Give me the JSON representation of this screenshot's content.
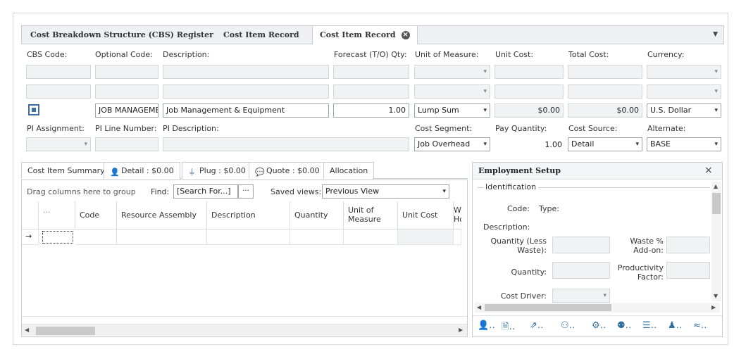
{
  "tabs": [
    {
      "label": "Cost Breakdown Structure (CBS) Register"
    },
    {
      "label": "Cost Item Record"
    },
    {
      "label": "Cost Item Record",
      "close": "⊗"
    }
  ],
  "header_labels": {
    "cbs_code": "CBS Code:",
    "optional_code": "Optional Code:",
    "description": "Description:",
    "forecast_qty": "Forecast (T/O) Qty:",
    "unit_of_measure": "Unit of Measure:",
    "unit_cost": "Unit Cost:",
    "total_cost": "Total Cost:",
    "currency": "Currency:"
  },
  "record": {
    "optional_code": "JOB MANAGEME",
    "description": "Job Management & Equipment",
    "forecast_qty": "1.00",
    "unit_of_measure": "Lump Sum",
    "unit_cost": "$0.00",
    "total_cost": "$0.00",
    "currency": "U.S. Dollar"
  },
  "pi_labels": {
    "pi_assignment": "PI Assignment:",
    "pi_line_number": "PI Line Number:",
    "pi_description": "PI Description:",
    "cost_segment": "Cost Segment:",
    "pay_quantity": "Pay Quantity:",
    "cost_source": "Cost Source:",
    "alternate": "Alternate:"
  },
  "pi_values": {
    "cost_segment": "Job Overhead",
    "pay_quantity": "1.00",
    "cost_source": "Detail",
    "alternate": "BASE"
  },
  "subtabs": [
    {
      "label": "Cost Item Summary"
    },
    {
      "label": "Detail : $0.00"
    },
    {
      "label": "Plug : $0.00"
    },
    {
      "label": "Quote : $0.00"
    },
    {
      "label": "Allocation"
    }
  ],
  "grid": {
    "drag_hint": "Drag columns here to group",
    "find_label": "Find:",
    "find_value": "[Search For...]",
    "ellipsis": "···",
    "saved_views_label": "Saved views:",
    "saved_views_value": "Previous View",
    "headers": [
      "...",
      "Code",
      "Resource Assembly",
      "Description",
      "Quantity",
      "Unit of Measure",
      "Unit Cost",
      "Wo Hou"
    ],
    "row_arrow": "→"
  },
  "employment": {
    "title": "Employment Setup",
    "close": "×",
    "group": "Identification",
    "code_label": "Code:",
    "type_label": "Type:",
    "description_label": "Description:",
    "qty_less_waste_label": "Quantity (Less Waste):",
    "waste_label": "Waste % Add-on:",
    "quantity_label": "Quantity:",
    "productivity_label": "Productivity Factor:",
    "cost_driver_label": "Cost Driver:"
  },
  "colors": {
    "accent": "#2f6f9f",
    "active_checkbox": "#3a6ea5"
  }
}
